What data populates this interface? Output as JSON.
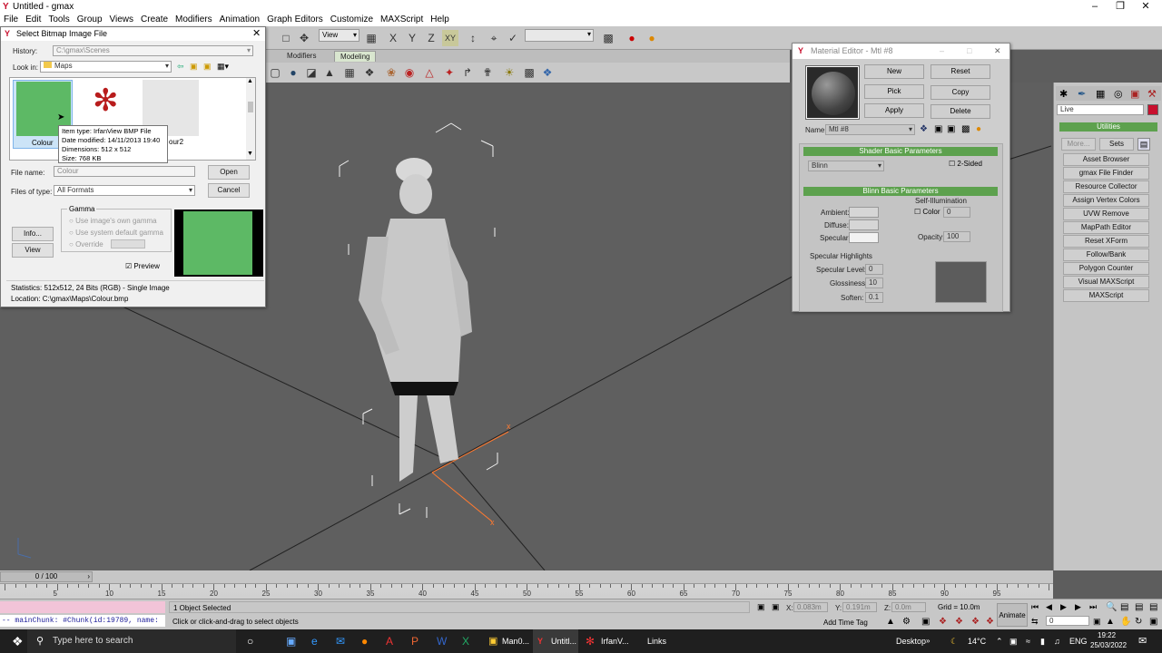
{
  "app": {
    "title": "Untitled - gmax"
  },
  "menu": [
    "File",
    "Edit",
    "Tools",
    "Group",
    "Views",
    "Create",
    "Modifiers",
    "Animation",
    "Graph Editors",
    "Customize",
    "MAXScript",
    "Help"
  ],
  "toolbar": {
    "view_dropdown": "View",
    "selection_set": ""
  },
  "tabs": [
    "Modifiers",
    "Modeling"
  ],
  "dialog": {
    "title": "Select Bitmap Image File",
    "history_label": "History:",
    "history_value": "C:\\gmax\\Scenes",
    "lookin_label": "Look in:",
    "lookin_value": "Maps",
    "thumbs": [
      {
        "label": "Colour"
      },
      {
        "label": ""
      },
      {
        "label": "our2"
      }
    ],
    "tooltip": {
      "type": "Item type: IrfanView BMP File",
      "date": "Date modified: 14/11/2013 19:40",
      "dims": "Dimensions: 512 x 512",
      "size": "Size: 768 KB"
    },
    "filename_label": "File name:",
    "filename_value": "Colour",
    "filetype_label": "Files of type:",
    "filetype_value": "All Formats",
    "open_label": "Open",
    "cancel_label": "Cancel",
    "gamma_label": "Gamma",
    "gamma_opts": [
      "Use image's own gamma",
      "Use system default gamma",
      "Override"
    ],
    "info_label": "Info...",
    "view_label": "View",
    "preview_label": "Preview",
    "stats": "Statistics:  512x512, 24 Bits (RGB) - Single Image",
    "location": "Location:  C:\\gmax\\Maps\\Colour.bmp"
  },
  "material": {
    "title": "Material Editor - Mtl #8",
    "buttons": {
      "new": "New",
      "reset": "Reset",
      "pick": "Pick",
      "copy": "Copy",
      "apply": "Apply",
      "delete": "Delete"
    },
    "name_label": "Name",
    "name_value": "Mtl #8",
    "shader_header": "Shader Basic Parameters",
    "shader_value": "Blinn",
    "two_sided": "2-Sided",
    "blinn_header": "Blinn Basic Parameters",
    "self_illum": "Self-Illumination",
    "color_label": "Color",
    "color_value": "0",
    "ambient": "Ambient:",
    "diffuse": "Diffuse:",
    "specular": "Specular:",
    "opacity_label": "Opacity:",
    "opacity_value": "100",
    "spec_highlights": "Specular Highlights",
    "spec_level_label": "Specular Level:",
    "spec_level_value": "0",
    "gloss_label": "Glossiness:",
    "gloss_value": "10",
    "soften_label": "Soften:",
    "soften_value": "0.1"
  },
  "command_panel": {
    "live_label": "Live",
    "utilities_header": "Utilities",
    "more_label": "More...",
    "sets_label": "Sets",
    "items": [
      "Asset Browser",
      "gmax File Finder",
      "Resource Collector",
      "Assign Vertex Colors",
      "UVW Remove",
      "MapPath Editor",
      "Reset XForm",
      "Follow/Bank",
      "Polygon Counter",
      "Visual MAXScript",
      "MAXScript"
    ]
  },
  "timeline": {
    "frame": "0 / 100",
    "ticks": [
      "5",
      "10",
      "15",
      "20",
      "25",
      "30",
      "35",
      "40",
      "45",
      "50",
      "55",
      "60",
      "65",
      "70",
      "75",
      "80",
      "85",
      "90",
      "95"
    ]
  },
  "status": {
    "script_line": "--  mainChunk: #Chunk(id:19789, name:",
    "selected": "1 Object Selected",
    "prompt": "Click or click-and-drag to select objects",
    "x_label": "X:",
    "x_value": "0.083m",
    "y_label": "Y:",
    "y_value": "0.191m",
    "z_label": "Z:",
    "z_value": "0.0m",
    "grid": "Grid = 10.0m",
    "add_time_tag": "Add Time Tag",
    "animate": "Animate",
    "frame_value": "0"
  },
  "taskbar": {
    "search_placeholder": "Type here to search",
    "apps": [
      {
        "label": "Man0..."
      },
      {
        "label": "Untitl..."
      },
      {
        "label": "IrfanV..."
      }
    ],
    "links": "Links",
    "desktop": "Desktop",
    "weather": "14°C",
    "lang": "ENG",
    "time": "19:22",
    "date": "25/03/2022"
  },
  "colors": {
    "accent_green": "#5db965",
    "rollout_green": "#5da14e",
    "red_logo": "#c8102e"
  }
}
